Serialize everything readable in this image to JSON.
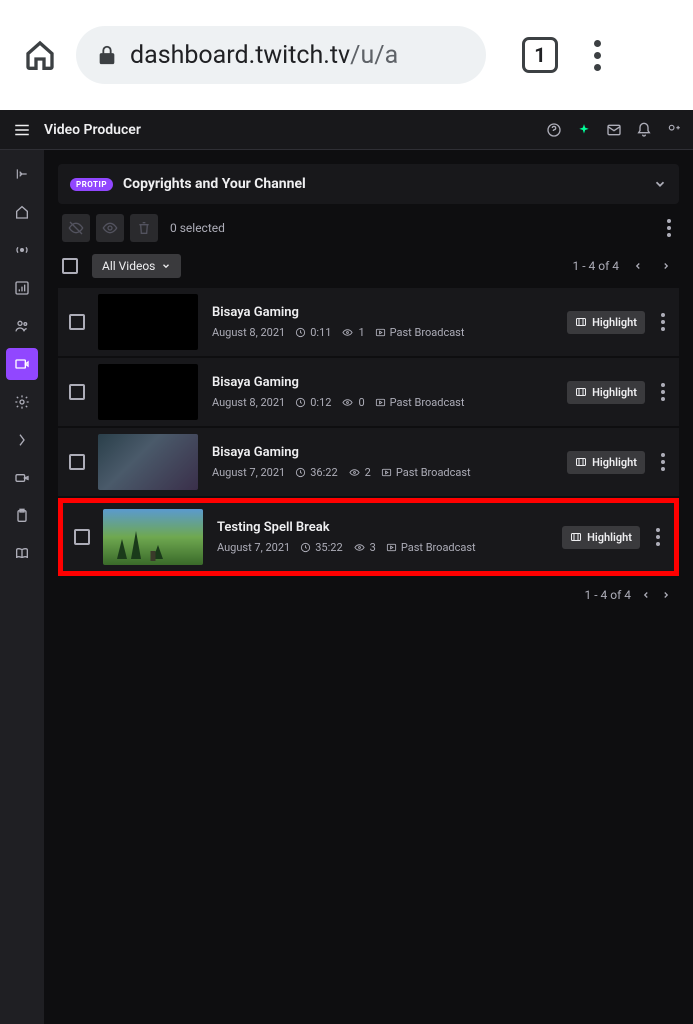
{
  "browser": {
    "url_main": "dashboard.twitch.tv",
    "url_path": "/u/a",
    "tab_count": "1"
  },
  "header": {
    "title": "Video Producer"
  },
  "banner": {
    "protip": "PROTIP",
    "title": "Copyrights and Your Channel"
  },
  "toolbar": {
    "selected_text": "0 selected"
  },
  "filter": {
    "label": "All Videos"
  },
  "pagination": {
    "range": "1 - 4 of 4"
  },
  "highlight_label": "Highlight",
  "videos": [
    {
      "title": "Bisaya Gaming",
      "date": "August 8, 2021",
      "duration": "0:11",
      "views": "1",
      "type": "Past Broadcast",
      "thumb_class": ""
    },
    {
      "title": "Bisaya Gaming",
      "date": "August 8, 2021",
      "duration": "0:12",
      "views": "0",
      "type": "Past Broadcast",
      "thumb_class": ""
    },
    {
      "title": "Bisaya Gaming",
      "date": "August 7, 2021",
      "duration": "36:22",
      "views": "2",
      "type": "Past Broadcast",
      "thumb_class": "t3"
    },
    {
      "title": "Testing Spell Break",
      "date": "August 7, 2021",
      "duration": "35:22",
      "views": "3",
      "type": "Past Broadcast",
      "thumb_class": "t4",
      "highlighted": true
    }
  ]
}
